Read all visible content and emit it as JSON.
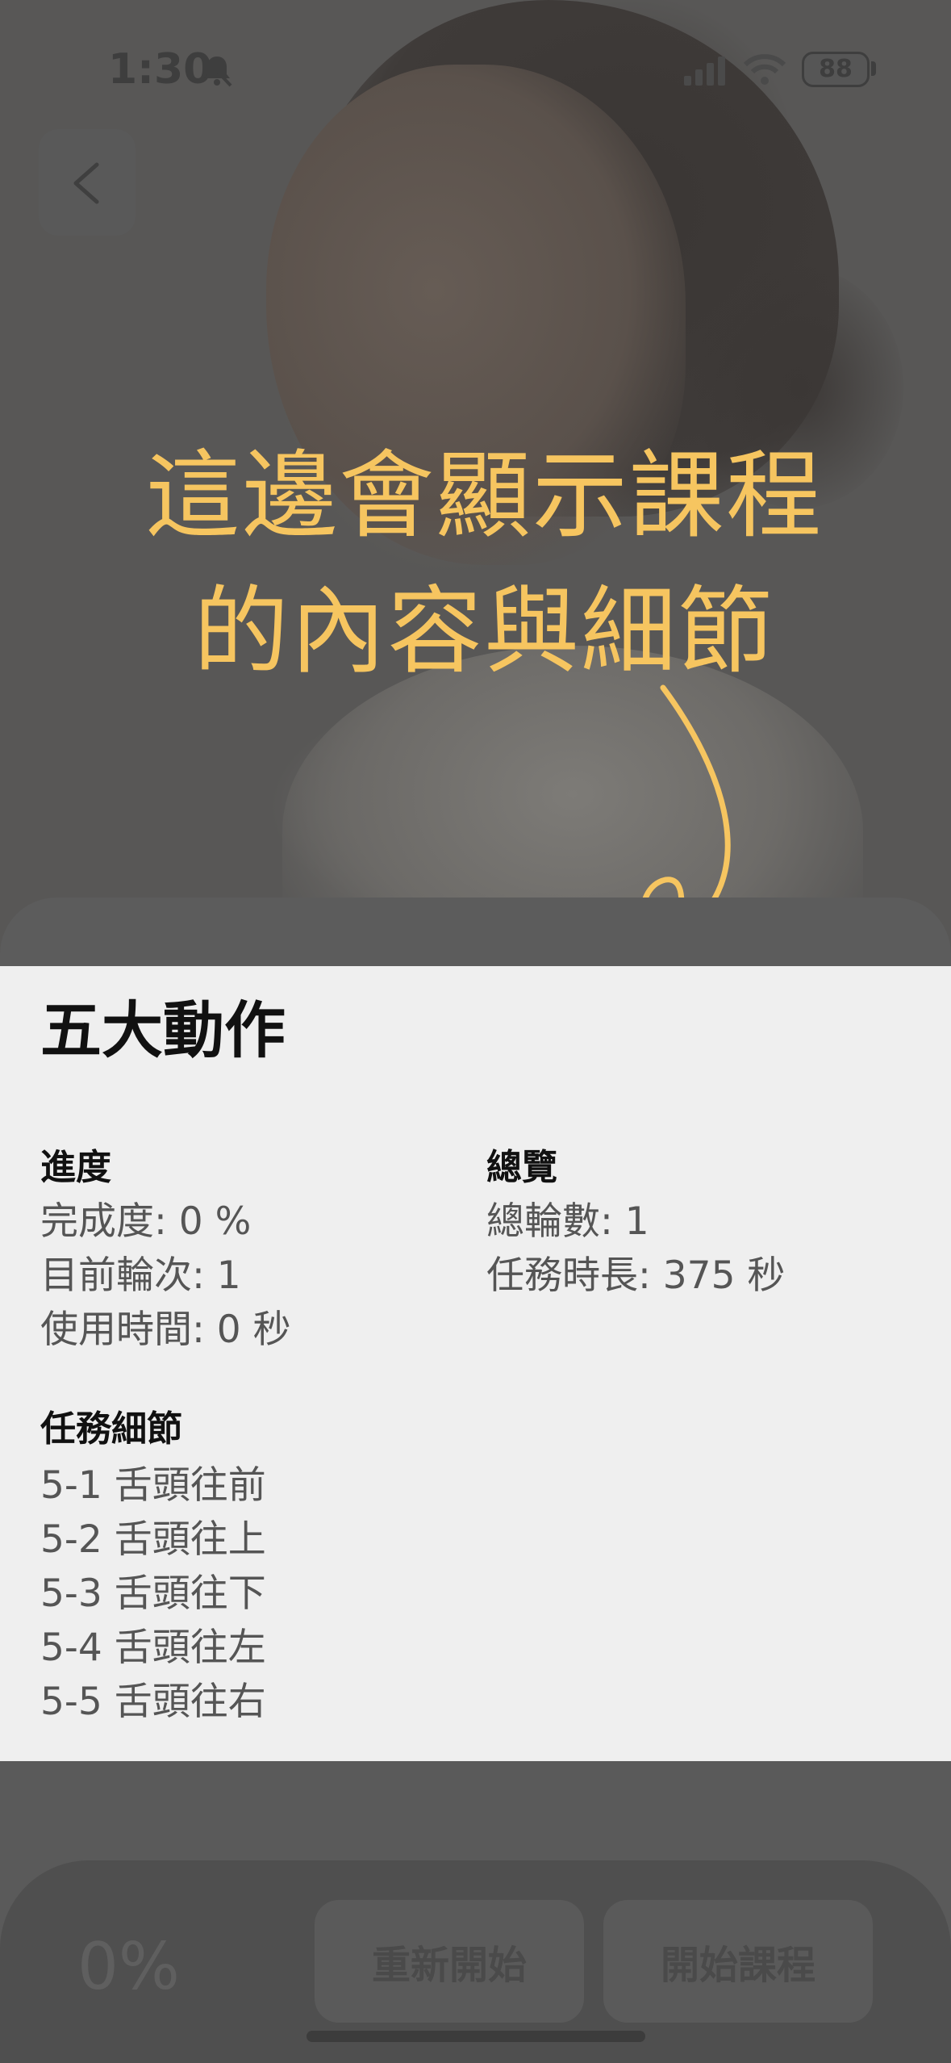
{
  "status_bar": {
    "time": "1:30",
    "battery": "88"
  },
  "annotation": {
    "line1": "這邊會顯示課程",
    "line2": "的內容與細節"
  },
  "course": {
    "title": "五大動作"
  },
  "progress": {
    "heading": "進度",
    "completion": "完成度: 0 %",
    "current_round": "目前輪次: 1",
    "time_used": "使用時間: 0 秒"
  },
  "overview": {
    "heading": "總覽",
    "total_rounds": "總輪數: 1",
    "task_duration": "任務時長: 375 秒"
  },
  "task_details": {
    "heading": "任務細節",
    "items": [
      "5-1 舌頭往前",
      "5-2 舌頭往上",
      "5-3 舌頭往下",
      "5-4 舌頭往左",
      "5-5 舌頭往右"
    ]
  },
  "bottom": {
    "progress_percent": "0%",
    "restart_label": "重新開始",
    "start_label": "開始課程"
  },
  "colors": {
    "annotation": "#f6c560",
    "overlay": "#5a5a5a",
    "panel": "#efefef"
  }
}
